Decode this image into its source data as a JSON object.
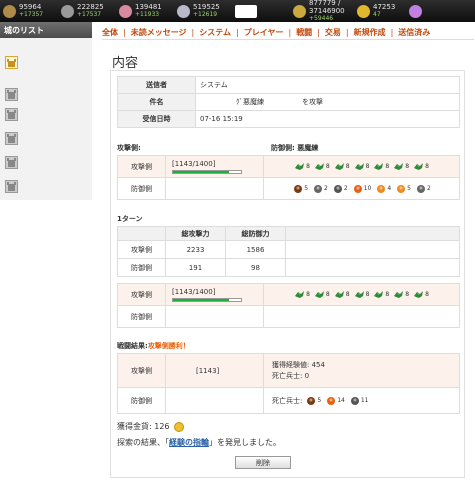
{
  "resources": [
    {
      "icon": "wood-icon",
      "color": "#b08a4a",
      "value": "95964",
      "delta": "+17357"
    },
    {
      "icon": "stone-icon",
      "color": "#9a9a9a",
      "value": "222825",
      "delta": "+17537"
    },
    {
      "icon": "food-icon",
      "color": "#d88aa0",
      "value": "139481",
      "delta": "+11933"
    },
    {
      "icon": "iron-icon",
      "color": "#b8b8c8",
      "value": "519525",
      "delta": "+12619"
    },
    {
      "icon": "hidden-resource-icon",
      "color": "#ffffff",
      "value": "",
      "delta": ""
    },
    {
      "icon": "population-icon",
      "color": "#c9a840",
      "value": "877779 / 37146900",
      "delta": "+59446"
    },
    {
      "icon": "gold-icon",
      "color": "#e0b830",
      "value": "47253",
      "delta": "47"
    },
    {
      "icon": "gem-icon",
      "color": "#c080e0",
      "value": "",
      "delta": ""
    }
  ],
  "sidebar": {
    "title": "城のリスト"
  },
  "nav": [
    "全体",
    "未読メッセージ",
    "システム",
    "プレイヤー",
    "戦闘",
    "交易",
    "新規作成",
    "送信済み"
  ],
  "page_title": "内容",
  "header": {
    "sender_label": "送信者",
    "sender": "システム",
    "subject_label": "件名",
    "subject_left": "ｸﾞ悪魔練",
    "subject_right": "を攻撃",
    "date_label": "受信日時",
    "date": "07-16 15:19"
  },
  "battle": {
    "attacker_side": "攻撃側:",
    "defender_side": "防御側: 悪魔練",
    "row_attacker": "攻撃側",
    "row_defender": "防御側",
    "hp_text": "[1143/1400]",
    "hp_fraction": 0.8164,
    "attacker_units": [
      "8",
      "8",
      "8",
      "8",
      "8",
      "8",
      "8"
    ],
    "defender_units": [
      {
        "icon": "brute-icon",
        "n": "5"
      },
      {
        "icon": "skull-icon",
        "n": "2"
      },
      {
        "icon": "soldier-icon",
        "n": "2"
      },
      {
        "icon": "fire-icon",
        "n": "10"
      },
      {
        "icon": "flame-icon",
        "n": "4"
      },
      {
        "icon": "flame-icon",
        "n": "5"
      },
      {
        "icon": "skull-icon",
        "n": "2"
      }
    ]
  },
  "turn": {
    "title": "1ターン",
    "col_attack": "総攻撃力",
    "col_defense": "総防御力",
    "rows": [
      {
        "label": "攻撃側",
        "atk": "2233",
        "def": "1586"
      },
      {
        "label": "防御側",
        "atk": "191",
        "def": "98"
      }
    ],
    "hp_text": "[1143/1400]",
    "hp_fraction": 0.8164,
    "attacker_units": [
      "8",
      "8",
      "8",
      "8",
      "8",
      "8",
      "8"
    ]
  },
  "result": {
    "title_prefix": "戦闘結果:",
    "title_value": "攻撃側勝利！",
    "attacker_label": "攻撃側",
    "attacker_hp": "[1143]",
    "exp_label": "獲得経験値: 454",
    "dead_attacker": "死亡兵士: 0",
    "defender_label": "防御側",
    "dead_defender_label": "死亡兵士:",
    "dead_defender_units": [
      {
        "icon": "brute-icon",
        "n": "5"
      },
      {
        "icon": "fire-icon",
        "n": "14"
      },
      {
        "icon": "soldier-icon",
        "n": "11"
      }
    ]
  },
  "gold": {
    "label": "獲得金貨: 126"
  },
  "explore": {
    "prefix": "探索の結果、「",
    "item": "経験の指輪",
    "suffix": "」を発見しました。"
  },
  "delete_button": "削除"
}
